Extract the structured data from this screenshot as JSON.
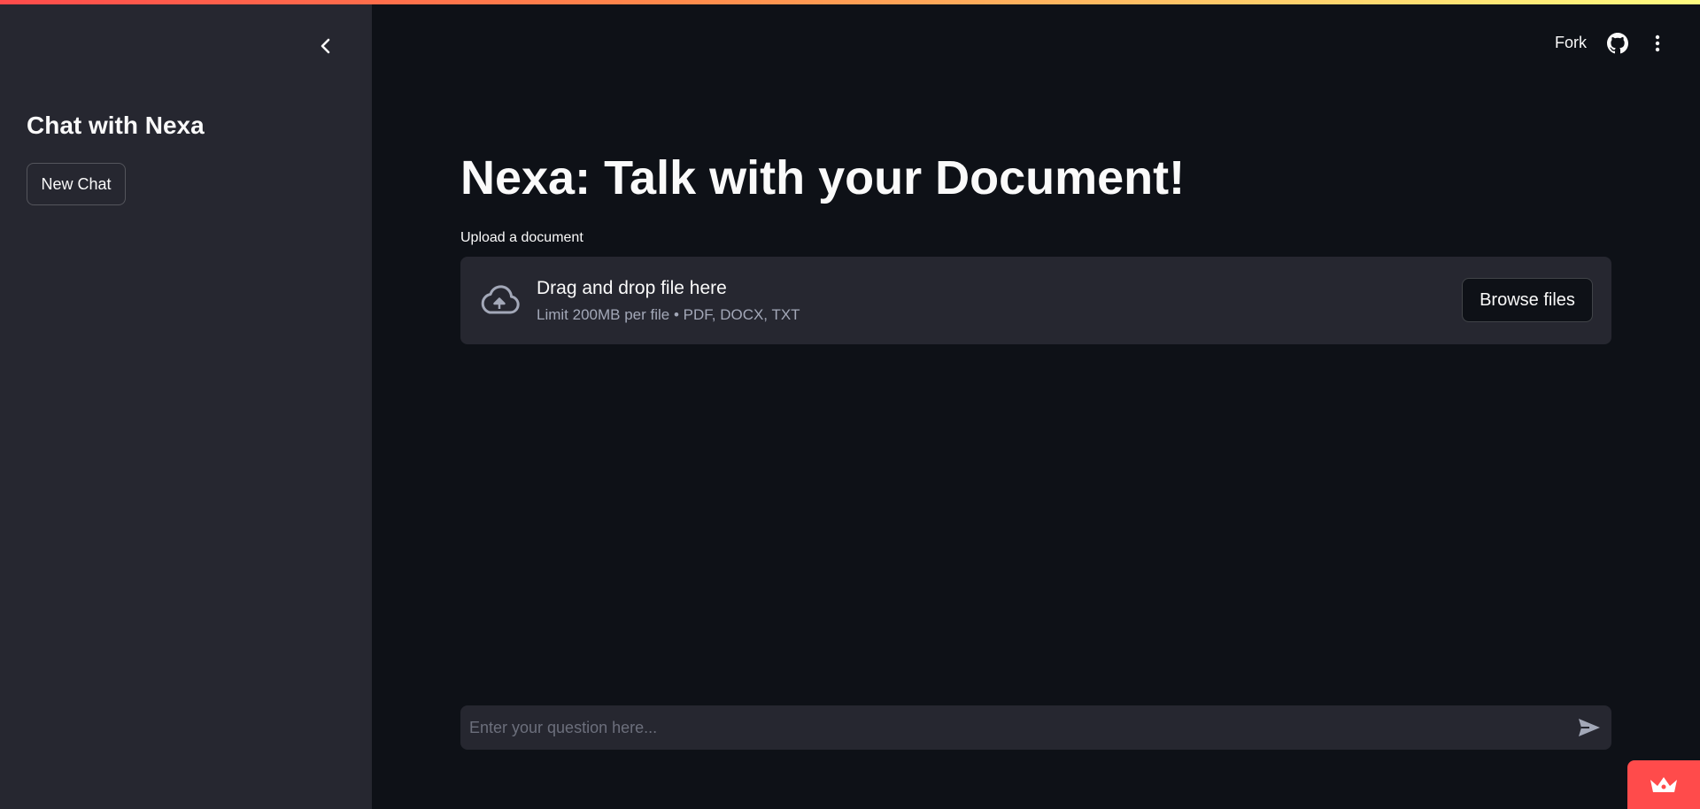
{
  "sidebar": {
    "title": "Chat with Nexa",
    "new_chat_label": "New Chat"
  },
  "header": {
    "fork_label": "Fork",
    "github_icon": "github-icon",
    "menu_icon": "more-vertical-icon"
  },
  "main": {
    "title": "Nexa: Talk with your Document!",
    "upload": {
      "label": "Upload a document",
      "drop_text": "Drag and drop file here",
      "limit_text": "Limit 200MB per file • PDF, DOCX, TXT",
      "browse_label": "Browse files"
    },
    "chat": {
      "placeholder": "Enter your question here..."
    }
  },
  "colors": {
    "background": "#0e1117",
    "sidebar": "#262730",
    "accent": "#ff4b4b",
    "text": "#fafafa",
    "muted": "#a3a8b8"
  }
}
